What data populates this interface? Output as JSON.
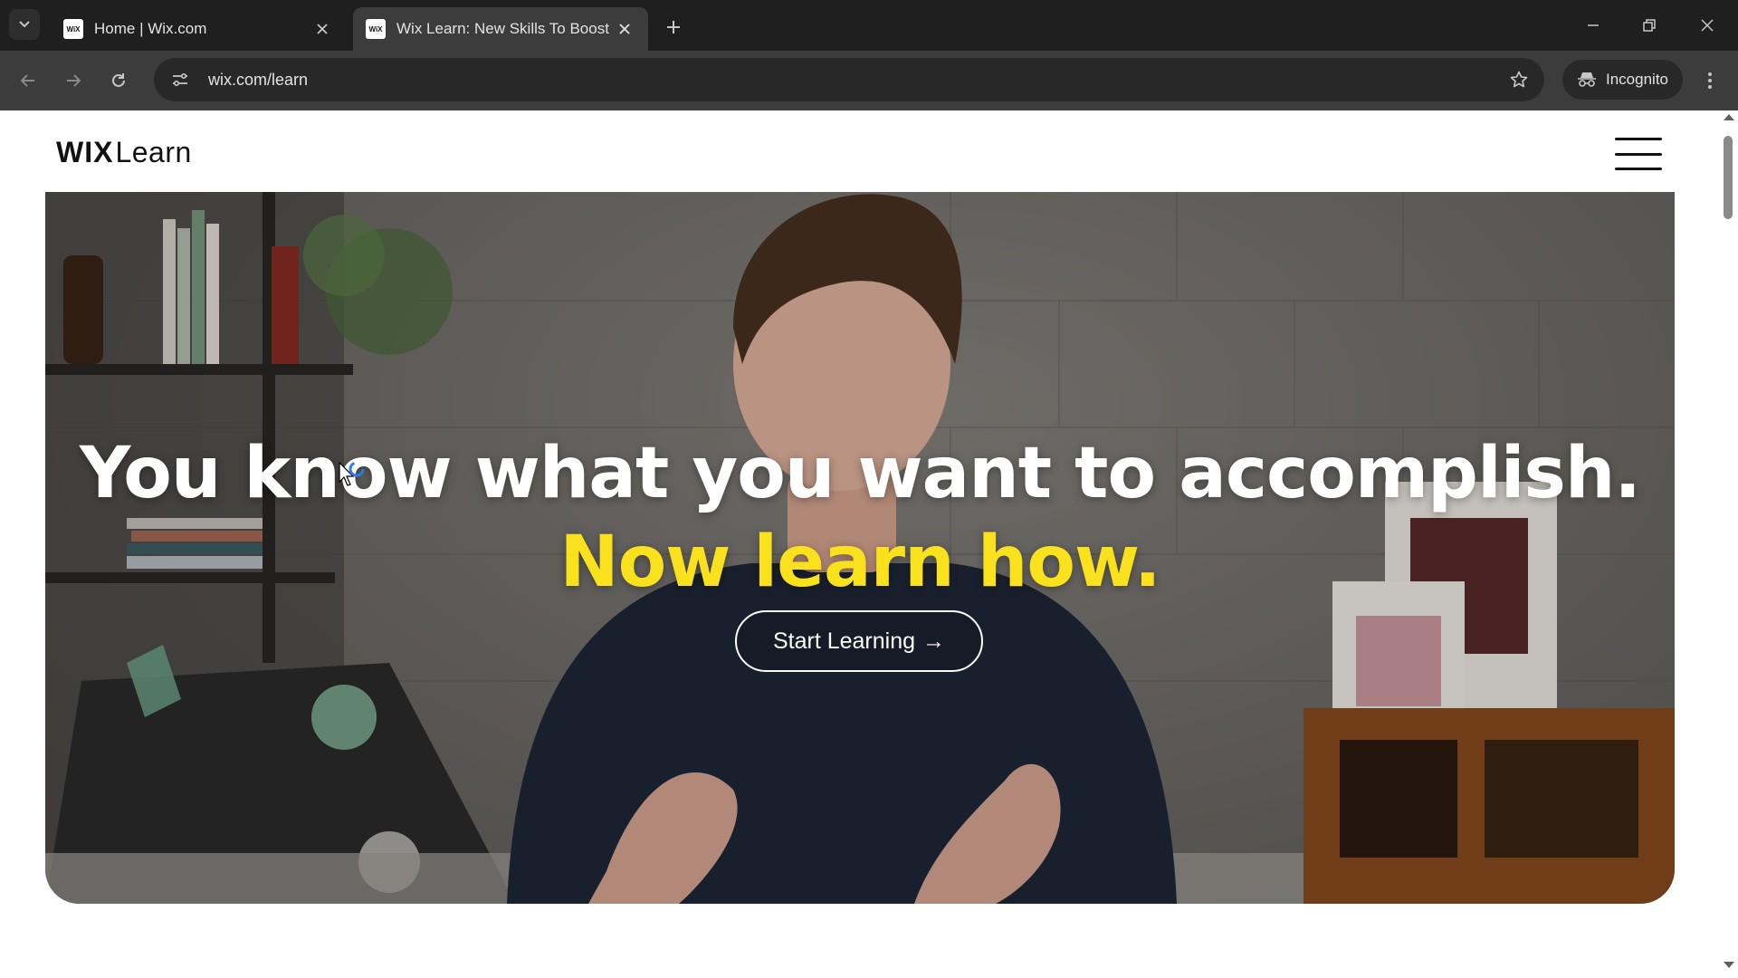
{
  "browser": {
    "tabs": [
      {
        "title": "Home | Wix.com",
        "favicon_text": "WiX",
        "active": false
      },
      {
        "title": "Wix Learn: New Skills To Boost",
        "favicon_text": "WiX",
        "active": true
      }
    ],
    "address": "wix.com/learn",
    "incognito_label": "Incognito",
    "colors": {
      "tabstrip": "#1f1f1f",
      "toolbar": "#3c3c3c",
      "omnibox": "#282828"
    }
  },
  "site": {
    "logo": {
      "wix": "WIX",
      "learn": "Learn"
    },
    "menu_icon": "hamburger-menu-icon"
  },
  "hero": {
    "headline_part1": "You know what you want to accomplish.",
    "headline_accent": "Now learn how.",
    "cta_label": "Start Learning",
    "cta_arrow": "→",
    "accent_color": "#f9e11e"
  }
}
